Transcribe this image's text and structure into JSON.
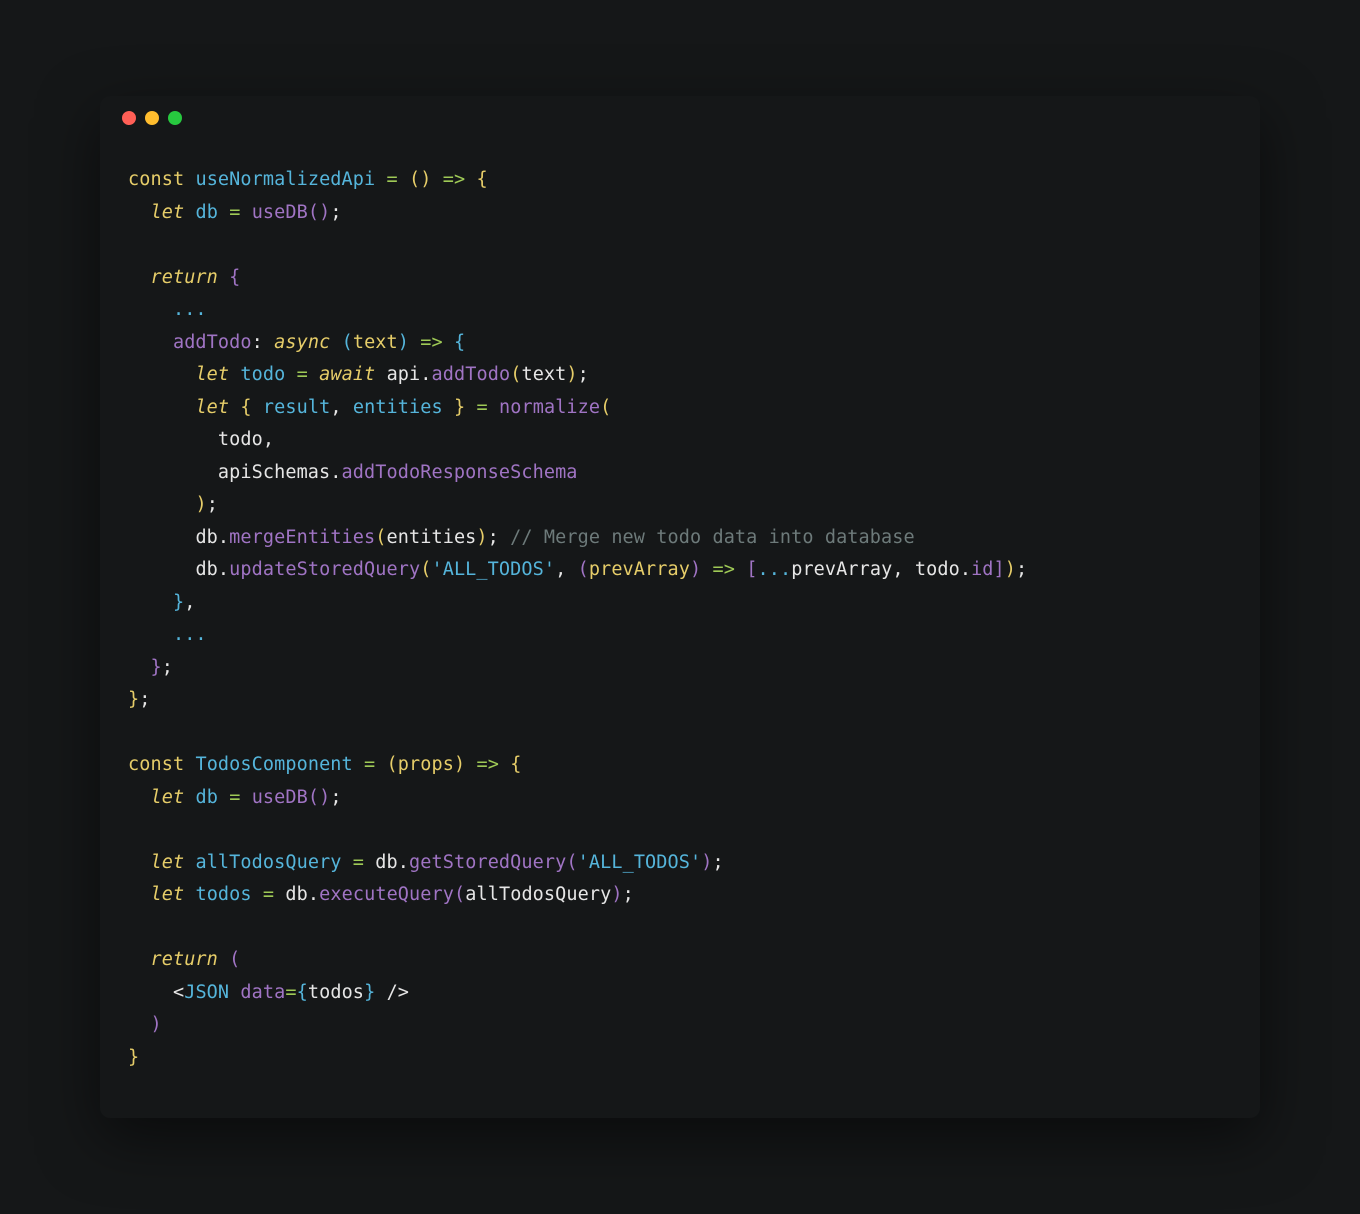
{
  "traffic_lights": {
    "red": "#ff5f56",
    "yellow": "#ffbd2e",
    "green": "#27c93f"
  },
  "code": {
    "lines": [
      [
        {
          "c": "tok-const",
          "t": "const"
        },
        {
          "t": " "
        },
        {
          "c": "tok-name-decl",
          "t": "useNormalizedApi"
        },
        {
          "t": " "
        },
        {
          "c": "tok-op",
          "t": "="
        },
        {
          "t": " "
        },
        {
          "c": "tok-paren-y",
          "t": "("
        },
        {
          "c": "tok-paren-y",
          "t": ")"
        },
        {
          "t": " "
        },
        {
          "c": "tok-arrow",
          "t": "=>"
        },
        {
          "t": " "
        },
        {
          "c": "tok-paren-y",
          "t": "{"
        }
      ],
      [
        {
          "t": "  "
        },
        {
          "c": "tok-kw",
          "t": "let"
        },
        {
          "t": " "
        },
        {
          "c": "tok-name-decl",
          "t": "db"
        },
        {
          "t": " "
        },
        {
          "c": "tok-op",
          "t": "="
        },
        {
          "t": " "
        },
        {
          "c": "tok-call",
          "t": "useDB"
        },
        {
          "c": "tok-paren-p",
          "t": "("
        },
        {
          "c": "tok-paren-p",
          "t": ")"
        },
        {
          "c": "tok-punc",
          "t": ";"
        }
      ],
      [
        {
          "t": ""
        }
      ],
      [
        {
          "t": "  "
        },
        {
          "c": "tok-kw",
          "t": "return"
        },
        {
          "t": " "
        },
        {
          "c": "tok-paren-p",
          "t": "{"
        }
      ],
      [
        {
          "t": "    "
        },
        {
          "c": "tok-spread",
          "t": "..."
        }
      ],
      [
        {
          "t": "    "
        },
        {
          "c": "tok-prop",
          "t": "addTodo"
        },
        {
          "c": "tok-punc",
          "t": ":"
        },
        {
          "t": " "
        },
        {
          "c": "tok-kw",
          "t": "async"
        },
        {
          "t": " "
        },
        {
          "c": "tok-paren-b",
          "t": "("
        },
        {
          "c": "tok-param",
          "t": "text"
        },
        {
          "c": "tok-paren-b",
          "t": ")"
        },
        {
          "t": " "
        },
        {
          "c": "tok-arrow",
          "t": "=>"
        },
        {
          "t": " "
        },
        {
          "c": "tok-paren-b",
          "t": "{"
        }
      ],
      [
        {
          "t": "      "
        },
        {
          "c": "tok-kw",
          "t": "let"
        },
        {
          "t": " "
        },
        {
          "c": "tok-name-decl",
          "t": "todo"
        },
        {
          "t": " "
        },
        {
          "c": "tok-op",
          "t": "="
        },
        {
          "t": " "
        },
        {
          "c": "tok-kw",
          "t": "await"
        },
        {
          "t": " "
        },
        {
          "c": "tok-var",
          "t": "api"
        },
        {
          "c": "tok-punc",
          "t": "."
        },
        {
          "c": "tok-call",
          "t": "addTodo"
        },
        {
          "c": "tok-paren-y",
          "t": "("
        },
        {
          "c": "tok-var",
          "t": "text"
        },
        {
          "c": "tok-paren-y",
          "t": ")"
        },
        {
          "c": "tok-punc",
          "t": ";"
        }
      ],
      [
        {
          "t": "      "
        },
        {
          "c": "tok-kw",
          "t": "let"
        },
        {
          "t": " "
        },
        {
          "c": "tok-paren-y",
          "t": "{"
        },
        {
          "t": " "
        },
        {
          "c": "tok-name-decl",
          "t": "result"
        },
        {
          "c": "tok-punc",
          "t": ","
        },
        {
          "t": " "
        },
        {
          "c": "tok-name-decl",
          "t": "entities"
        },
        {
          "t": " "
        },
        {
          "c": "tok-paren-y",
          "t": "}"
        },
        {
          "t": " "
        },
        {
          "c": "tok-op",
          "t": "="
        },
        {
          "t": " "
        },
        {
          "c": "tok-call",
          "t": "normalize"
        },
        {
          "c": "tok-paren-y",
          "t": "("
        }
      ],
      [
        {
          "t": "        "
        },
        {
          "c": "tok-var",
          "t": "todo"
        },
        {
          "c": "tok-punc",
          "t": ","
        }
      ],
      [
        {
          "t": "        "
        },
        {
          "c": "tok-var",
          "t": "apiSchemas"
        },
        {
          "c": "tok-punc",
          "t": "."
        },
        {
          "c": "tok-prop",
          "t": "addTodoResponseSchema"
        }
      ],
      [
        {
          "t": "      "
        },
        {
          "c": "tok-paren-y",
          "t": ")"
        },
        {
          "c": "tok-punc",
          "t": ";"
        }
      ],
      [
        {
          "t": "      "
        },
        {
          "c": "tok-var",
          "t": "db"
        },
        {
          "c": "tok-punc",
          "t": "."
        },
        {
          "c": "tok-call",
          "t": "mergeEntities"
        },
        {
          "c": "tok-paren-y",
          "t": "("
        },
        {
          "c": "tok-var",
          "t": "entities"
        },
        {
          "c": "tok-paren-y",
          "t": ")"
        },
        {
          "c": "tok-punc",
          "t": ";"
        },
        {
          "t": " "
        },
        {
          "c": "tok-comment",
          "t": "// Merge new todo data into database"
        }
      ],
      [
        {
          "t": "      "
        },
        {
          "c": "tok-var",
          "t": "db"
        },
        {
          "c": "tok-punc",
          "t": "."
        },
        {
          "c": "tok-call",
          "t": "updateStoredQuery"
        },
        {
          "c": "tok-paren-y",
          "t": "("
        },
        {
          "c": "tok-string",
          "t": "'ALL_TODOS'"
        },
        {
          "c": "tok-punc",
          "t": ","
        },
        {
          "t": " "
        },
        {
          "c": "tok-paren-p",
          "t": "("
        },
        {
          "c": "tok-param",
          "t": "prevArray"
        },
        {
          "c": "tok-paren-p",
          "t": ")"
        },
        {
          "t": " "
        },
        {
          "c": "tok-arrow",
          "t": "=>"
        },
        {
          "t": " "
        },
        {
          "c": "tok-paren-p",
          "t": "["
        },
        {
          "c": "tok-spread",
          "t": "..."
        },
        {
          "c": "tok-var",
          "t": "prevArray"
        },
        {
          "c": "tok-punc",
          "t": ","
        },
        {
          "t": " "
        },
        {
          "c": "tok-var",
          "t": "todo"
        },
        {
          "c": "tok-punc",
          "t": "."
        },
        {
          "c": "tok-prop",
          "t": "id"
        },
        {
          "c": "tok-paren-p",
          "t": "]"
        },
        {
          "c": "tok-paren-y",
          "t": ")"
        },
        {
          "c": "tok-punc",
          "t": ";"
        }
      ],
      [
        {
          "t": "    "
        },
        {
          "c": "tok-paren-b",
          "t": "}"
        },
        {
          "c": "tok-punc",
          "t": ","
        }
      ],
      [
        {
          "t": "    "
        },
        {
          "c": "tok-spread",
          "t": "..."
        }
      ],
      [
        {
          "t": "  "
        },
        {
          "c": "tok-paren-p",
          "t": "}"
        },
        {
          "c": "tok-punc",
          "t": ";"
        }
      ],
      [
        {
          "c": "tok-paren-y",
          "t": "}"
        },
        {
          "c": "tok-punc",
          "t": ";"
        }
      ],
      [
        {
          "t": ""
        }
      ],
      [
        {
          "c": "tok-const",
          "t": "const"
        },
        {
          "t": " "
        },
        {
          "c": "tok-name-decl",
          "t": "TodosComponent"
        },
        {
          "t": " "
        },
        {
          "c": "tok-op",
          "t": "="
        },
        {
          "t": " "
        },
        {
          "c": "tok-paren-y",
          "t": "("
        },
        {
          "c": "tok-param",
          "t": "props"
        },
        {
          "c": "tok-paren-y",
          "t": ")"
        },
        {
          "t": " "
        },
        {
          "c": "tok-arrow",
          "t": "=>"
        },
        {
          "t": " "
        },
        {
          "c": "tok-paren-y",
          "t": "{"
        }
      ],
      [
        {
          "t": "  "
        },
        {
          "c": "tok-kw",
          "t": "let"
        },
        {
          "t": " "
        },
        {
          "c": "tok-name-decl",
          "t": "db"
        },
        {
          "t": " "
        },
        {
          "c": "tok-op",
          "t": "="
        },
        {
          "t": " "
        },
        {
          "c": "tok-call",
          "t": "useDB"
        },
        {
          "c": "tok-paren-p",
          "t": "("
        },
        {
          "c": "tok-paren-p",
          "t": ")"
        },
        {
          "c": "tok-punc",
          "t": ";"
        }
      ],
      [
        {
          "t": ""
        }
      ],
      [
        {
          "t": "  "
        },
        {
          "c": "tok-kw",
          "t": "let"
        },
        {
          "t": " "
        },
        {
          "c": "tok-name-decl",
          "t": "allTodosQuery"
        },
        {
          "t": " "
        },
        {
          "c": "tok-op",
          "t": "="
        },
        {
          "t": " "
        },
        {
          "c": "tok-var",
          "t": "db"
        },
        {
          "c": "tok-punc",
          "t": "."
        },
        {
          "c": "tok-call",
          "t": "getStoredQuery"
        },
        {
          "c": "tok-paren-p",
          "t": "("
        },
        {
          "c": "tok-string",
          "t": "'ALL_TODOS'"
        },
        {
          "c": "tok-paren-p",
          "t": ")"
        },
        {
          "c": "tok-punc",
          "t": ";"
        }
      ],
      [
        {
          "t": "  "
        },
        {
          "c": "tok-kw",
          "t": "let"
        },
        {
          "t": " "
        },
        {
          "c": "tok-name-decl",
          "t": "todos"
        },
        {
          "t": " "
        },
        {
          "c": "tok-op",
          "t": "="
        },
        {
          "t": " "
        },
        {
          "c": "tok-var",
          "t": "db"
        },
        {
          "c": "tok-punc",
          "t": "."
        },
        {
          "c": "tok-call",
          "t": "executeQuery"
        },
        {
          "c": "tok-paren-p",
          "t": "("
        },
        {
          "c": "tok-var",
          "t": "allTodosQuery"
        },
        {
          "c": "tok-paren-p",
          "t": ")"
        },
        {
          "c": "tok-punc",
          "t": ";"
        }
      ],
      [
        {
          "t": ""
        }
      ],
      [
        {
          "t": "  "
        },
        {
          "c": "tok-kw",
          "t": "return"
        },
        {
          "t": " "
        },
        {
          "c": "tok-paren-p",
          "t": "("
        }
      ],
      [
        {
          "t": "    "
        },
        {
          "c": "tok-angle",
          "t": "<"
        },
        {
          "c": "tok-tag",
          "t": "JSON"
        },
        {
          "t": " "
        },
        {
          "c": "tok-attr",
          "t": "data"
        },
        {
          "c": "tok-op",
          "t": "="
        },
        {
          "c": "tok-paren-b",
          "t": "{"
        },
        {
          "c": "tok-var",
          "t": "todos"
        },
        {
          "c": "tok-paren-b",
          "t": "}"
        },
        {
          "t": " "
        },
        {
          "c": "tok-angle",
          "t": "/>"
        }
      ],
      [
        {
          "t": "  "
        },
        {
          "c": "tok-paren-p",
          "t": ")"
        }
      ],
      [
        {
          "c": "tok-paren-y",
          "t": "}"
        }
      ]
    ]
  }
}
